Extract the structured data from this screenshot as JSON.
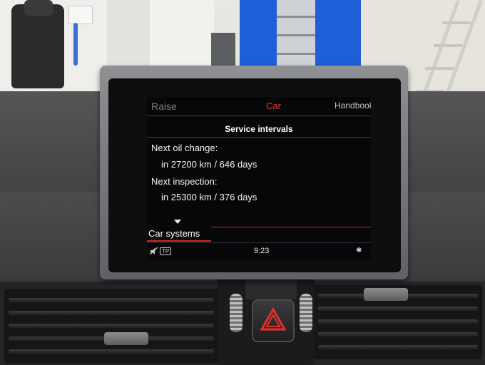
{
  "tabs": {
    "left": "Raise",
    "center": "Car",
    "right": "Handbook"
  },
  "screen_title": "Service intervals",
  "service": {
    "oil_heading": "Next oil change:",
    "oil_value": "in 27200 km / 646 days",
    "inspection_heading": "Next inspection:",
    "inspection_value": "in 25300 km / 376 days"
  },
  "bottom_tab": "Car systems",
  "status": {
    "clock": "9:23",
    "tp_label": "TP",
    "mute_icon": "mute-icon",
    "bluetooth_icon": "bluetooth-icon"
  },
  "colors": {
    "accent": "#e53830",
    "screen_bg": "#060708",
    "text": "#f4f4f4"
  }
}
